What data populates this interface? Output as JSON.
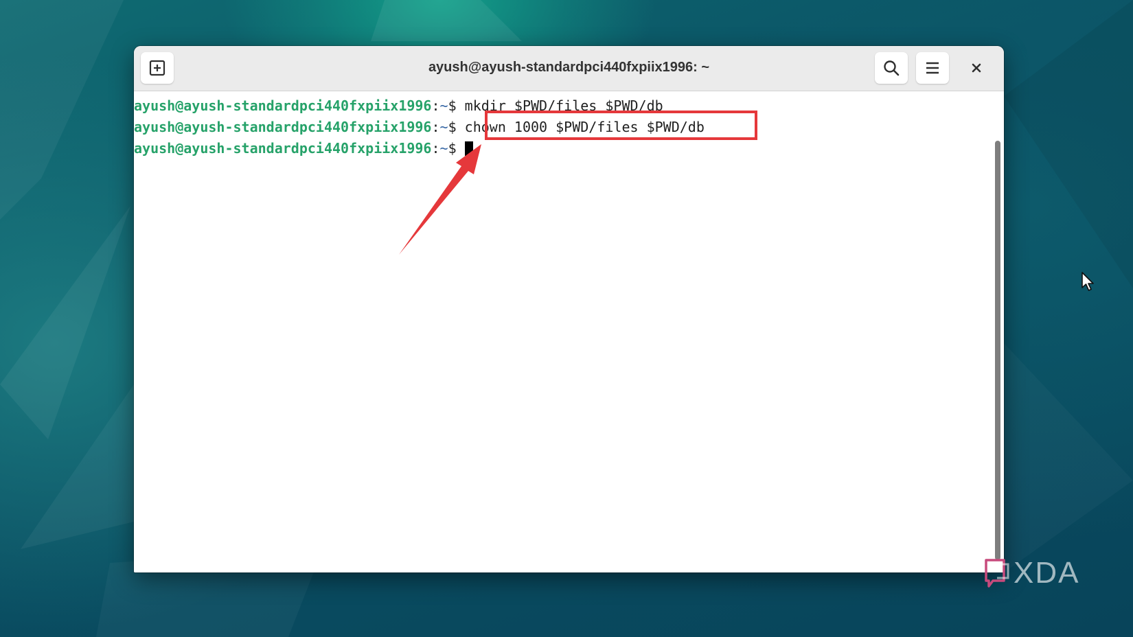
{
  "window": {
    "title": "ayush@ayush-standardpci440fxpiix1996: ~",
    "buttons": {
      "new_tab_icon": "plus-square-icon",
      "search_icon": "search-icon",
      "menu_icon": "hamburger-menu-icon",
      "close_icon": "close-icon"
    }
  },
  "terminal": {
    "prompt": {
      "user_host": "ayush@ayush-standardpci440fxpiix1996",
      "separator": ":",
      "path": "~",
      "symbol": "$"
    },
    "lines": [
      {
        "command": "mkdir $PWD/files $PWD/db"
      },
      {
        "command": "chown 1000 $PWD/files $PWD/db"
      },
      {
        "command": ""
      }
    ]
  },
  "annotation": {
    "highlight_color": "#e5383b",
    "highlighted_command": "chown 1000 $PWD/files $PWD/db"
  },
  "colors": {
    "prompt_user": "#26a269",
    "prompt_path": "#3465a4",
    "titlebar": "#ebebeb",
    "desktop": "#0b4c5c"
  },
  "watermark": {
    "text": "XDA"
  }
}
